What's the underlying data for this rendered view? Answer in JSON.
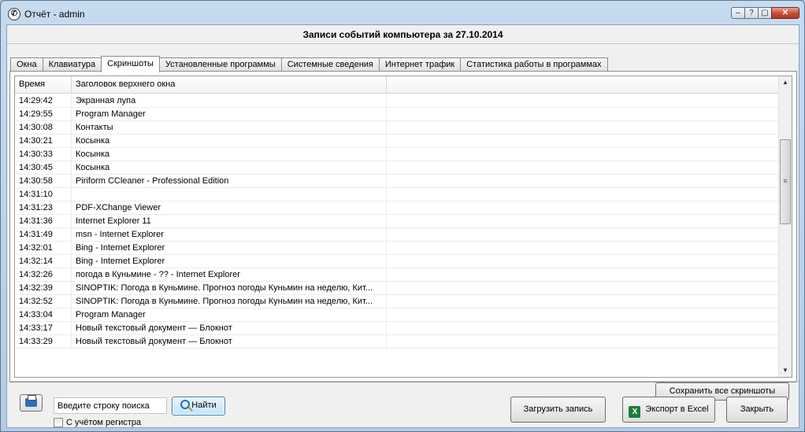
{
  "window": {
    "title": "Отчёт - admin",
    "icon": "app-logo-icon",
    "controls": [
      "help-icon",
      "minimize-icon",
      "maximize-icon",
      "close-icon"
    ]
  },
  "report": {
    "header": "Записи событий компьютера за 27.10.2014"
  },
  "tabs": [
    {
      "label": "Окна",
      "active": false
    },
    {
      "label": "Клавиатура",
      "active": false
    },
    {
      "label": "Скриншоты",
      "active": true
    },
    {
      "label": "Установленные программы",
      "active": false
    },
    {
      "label": "Системные сведения",
      "active": false
    },
    {
      "label": "Интернет трафик",
      "active": false
    },
    {
      "label": "Статистика работы в программах",
      "active": false
    }
  ],
  "table": {
    "columns": [
      "Время",
      "Заголовок верхнего окна",
      ""
    ],
    "rows": [
      [
        "14:29:42",
        "Экранная лупа"
      ],
      [
        "14:29:55",
        "Program Manager"
      ],
      [
        "14:30:08",
        "Контакты"
      ],
      [
        "14:30:21",
        "Косынка"
      ],
      [
        "14:30:33",
        "Косынка"
      ],
      [
        "14:30:45",
        "Косынка"
      ],
      [
        "14:30:58",
        "Piriform CCleaner - Professional Edition"
      ],
      [
        "14:31:10",
        ""
      ],
      [
        "14:31:23",
        "PDF-XChange Viewer"
      ],
      [
        "14:31:36",
        "Internet Explorer 11"
      ],
      [
        "14:31:49",
        "msn - Internet Explorer"
      ],
      [
        "14:32:01",
        "Bing - Internet Explorer"
      ],
      [
        "14:32:14",
        "Bing - Internet Explorer"
      ],
      [
        "14:32:26",
        "погода в Куньмине - ?? - Internet Explorer"
      ],
      [
        "14:32:39",
        "SINOPTIK: Погода в Куньмине. Прогноз погоды Куньмин на неделю, Кит..."
      ],
      [
        "14:32:52",
        "SINOPTIK: Погода в Куньмине. Прогноз погоды Куньмин на неделю, Кит..."
      ],
      [
        "14:33:04",
        "Program Manager"
      ],
      [
        "14:33:17",
        "Новый текстовый документ — Блокнот"
      ],
      [
        "14:33:29",
        "Новый текстовый документ — Блокнот"
      ]
    ]
  },
  "buttons": {
    "save_all": "Сохранить все скриншоты",
    "find": "Найти",
    "load": "Загрузить запись",
    "export": "Экспорт в Excel",
    "close": "Закрыть"
  },
  "search": {
    "value": "Введите строку поиска",
    "case_sensitive_label": "С учётом регистра",
    "case_sensitive_checked": false
  }
}
